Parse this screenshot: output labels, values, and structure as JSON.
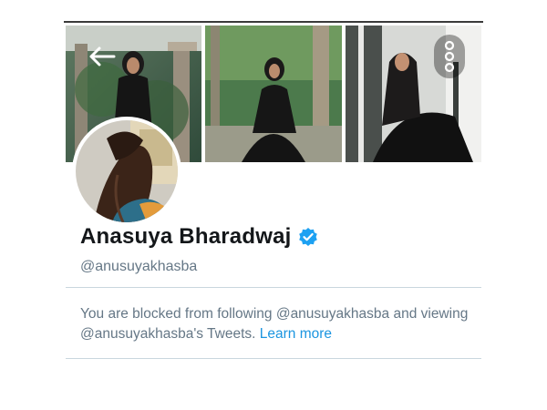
{
  "profile": {
    "display_name": "Anasuya Bharadwaj",
    "handle": "@anusuyakhasba",
    "verified": true
  },
  "blocked_notice": {
    "text": "You are blocked from following @anusuyakhasba and viewing @anusuyakhasba's Tweets.",
    "learn_more_label": "Learn more"
  },
  "icons": {
    "back": "arrow-left-icon",
    "more": "more-vertical-icon",
    "verified": "verified-badge-icon"
  },
  "colors": {
    "link": "#1b95e0",
    "verified_badge": "#1da1f2",
    "name_text": "#14171a",
    "secondary_text": "#657786",
    "divider": "#c9d6de"
  }
}
